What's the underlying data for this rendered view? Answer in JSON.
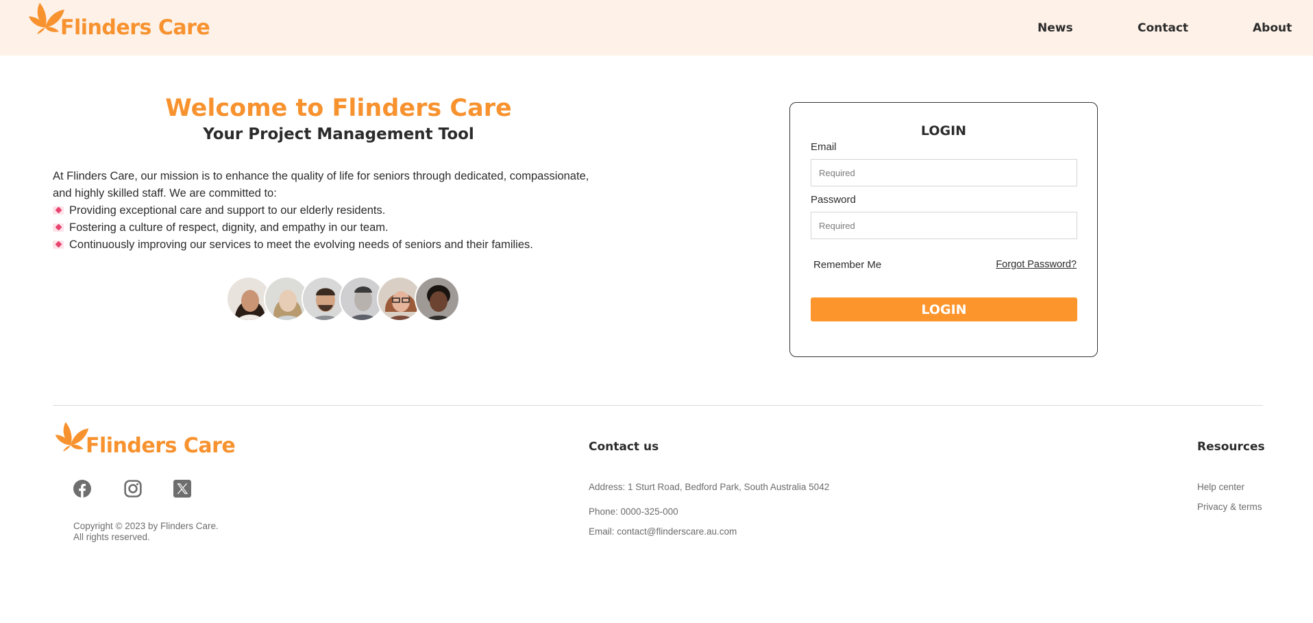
{
  "brand": {
    "name": "Flinders Care",
    "accent": "#f7922e",
    "header_bg": "#fdf1e8",
    "button_bg": "#fd952d"
  },
  "nav": {
    "items": [
      "News",
      "Contact",
      "About"
    ]
  },
  "hero": {
    "title": "Welcome to Flinders Care",
    "subtitle": "Your Project Management Tool",
    "mission_intro_1": "At Flinders Care, our mission is to enhance the quality of life for seniors through dedicated, compassionate,",
    "mission_intro_2": "and highly skilled staff. We are committed to:",
    "commitments": [
      "Providing exceptional care and support to our elderly residents.",
      "Fostering a culture of respect, dignity, and empathy in our team.",
      "Continuously improving our services to meet the evolving needs of seniors and their families."
    ],
    "bullet_icon": "heart-letter-icon"
  },
  "login": {
    "heading": "LOGIN",
    "email_label": "Email",
    "email_placeholder": "Required",
    "password_label": "Password",
    "password_placeholder": "Required",
    "remember_label": "Remember Me",
    "forgot_label": "Forgot Password?",
    "button_label": "LOGIN"
  },
  "footer": {
    "copyright_1": "Copyright © 2023 by Flinders Care.",
    "copyright_2": "All rights reserved.",
    "social_icons": [
      "facebook-icon",
      "instagram-icon",
      "x-twitter-icon"
    ],
    "contact": {
      "heading": "Contact us",
      "address": "Address: 1 Sturt Road, Bedford Park, South Australia 5042",
      "phone": "Phone: 0000-325-000",
      "email": "Email: contact@flinderscare.au.com"
    },
    "resources": {
      "heading": "Resources",
      "links": [
        "Help center",
        "Privacy & terms"
      ]
    }
  }
}
